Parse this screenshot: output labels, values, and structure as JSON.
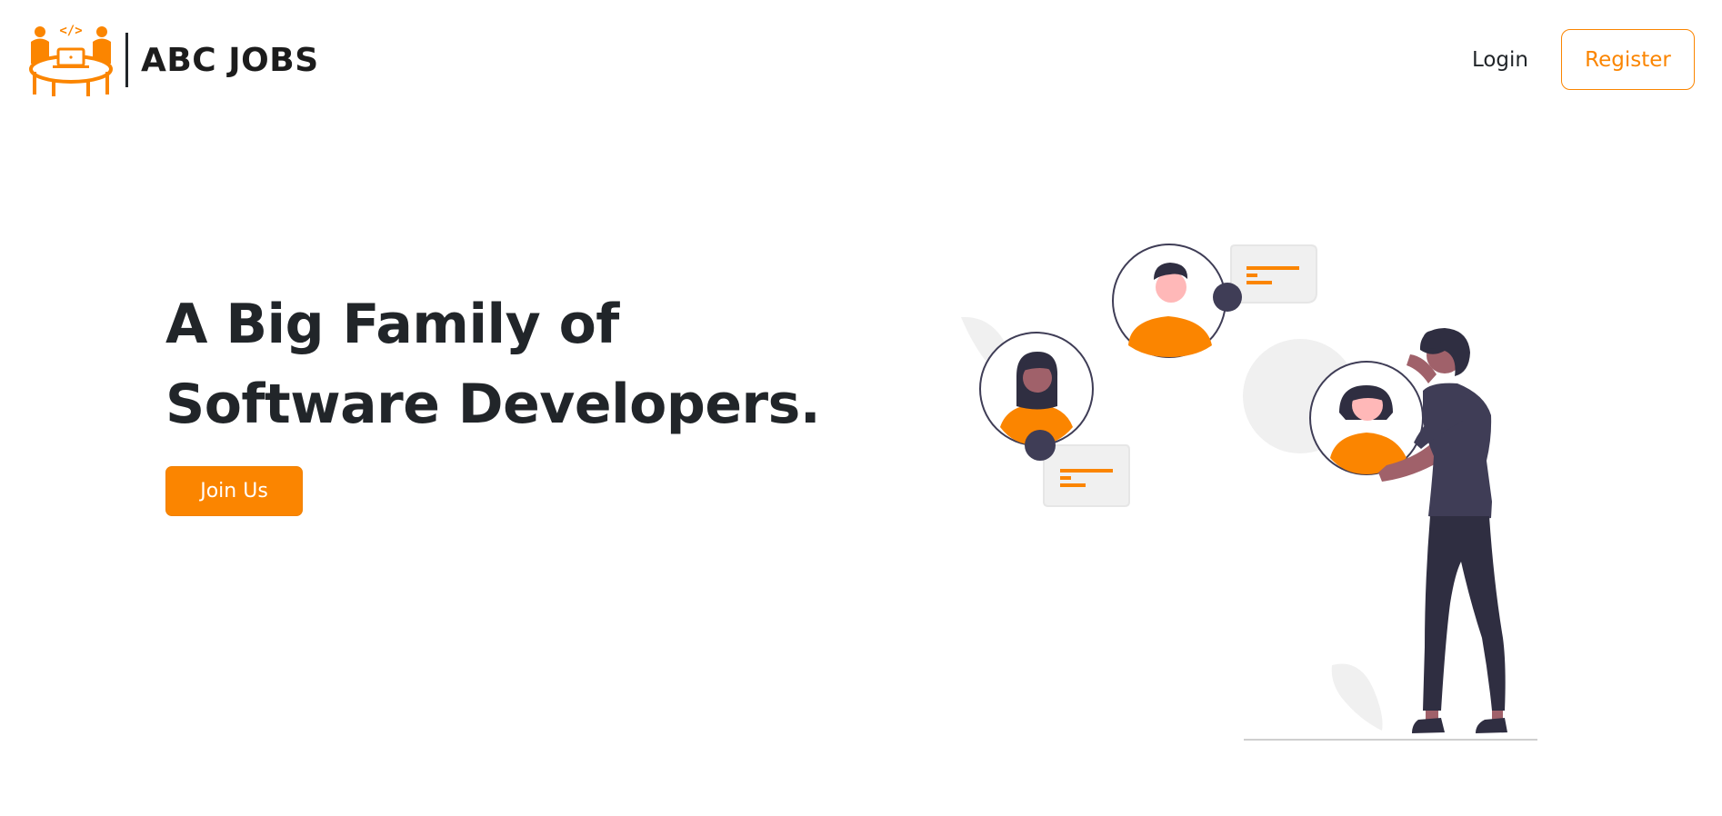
{
  "navbar": {
    "brand_name": "ABC JOBS",
    "logo_icon": "team-laptop-code-logo",
    "login_label": "Login",
    "register_label": "Register"
  },
  "hero": {
    "title_line1": "A Big Family of",
    "title_line2": "Software Developers.",
    "join_label": "Join Us",
    "illustration": "developer-network-illustration"
  },
  "colors": {
    "accent": "#fb8500",
    "text": "#212529",
    "figure_dark": "#3f3d56",
    "light_gray": "#f0f0f0"
  }
}
